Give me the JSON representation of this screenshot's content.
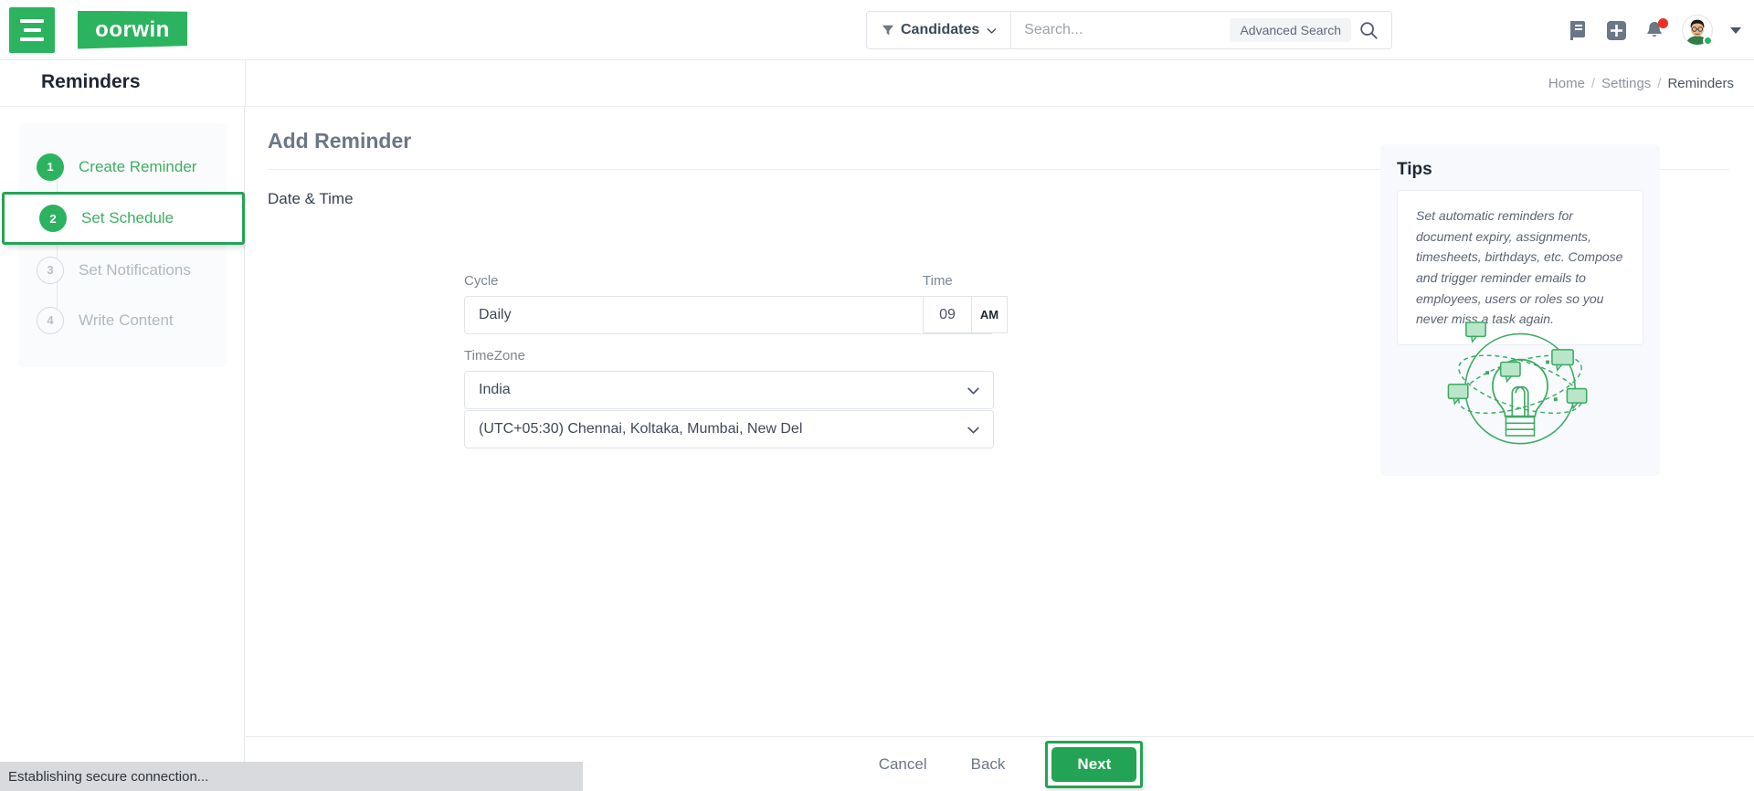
{
  "header": {
    "menu_icon": "hamburger-icon",
    "logo_text": "oorwin",
    "search": {
      "filter_label": "Candidates",
      "filter_icon": "funnel-icon",
      "chevron_icon": "chevron-down-icon",
      "placeholder": "Search...",
      "advanced_label": "Advanced Search",
      "search_icon": "search-icon"
    },
    "icons": [
      {
        "name": "note-add-icon"
      },
      {
        "name": "plus-square-icon"
      },
      {
        "name": "bell-icon",
        "has_badge": true
      }
    ],
    "avatar": {
      "name": "avatar",
      "status": "online"
    },
    "profile_caret": "caret-down-icon"
  },
  "subheader": {
    "title": "Reminders",
    "breadcrumb": [
      {
        "label": "Home",
        "active": false
      },
      {
        "label": "Settings",
        "active": false
      },
      {
        "label": "Reminders",
        "active": true
      }
    ],
    "separator": "/"
  },
  "stepper": {
    "steps": [
      {
        "num": "1",
        "label": "Create Reminder",
        "state": "done"
      },
      {
        "num": "2",
        "label": "Set Schedule",
        "state": "current"
      },
      {
        "num": "3",
        "label": "Set Notifications",
        "state": "todo"
      },
      {
        "num": "4",
        "label": "Write Content",
        "state": "todo"
      }
    ]
  },
  "main": {
    "title": "Add Reminder",
    "section_label": "Date & Time",
    "fields": {
      "cycle": {
        "label": "Cycle",
        "value": "Daily"
      },
      "timezone": {
        "label": "TimeZone",
        "value": "India"
      },
      "timezone_full": {
        "label": "",
        "value": "(UTC+05:30) Chennai, Koltaka, Mumbai, New Del"
      },
      "time": {
        "label": "Time",
        "hour": "09",
        "meridiem": "AM"
      }
    }
  },
  "tips": {
    "heading": "Tips",
    "body": "Set automatic reminders for document expiry, assignments, timesheets, birthdays, etc. Compose and trigger reminder emails to employees, users or roles so you never miss a task again.",
    "illustration": "lightbulb-network-illustration"
  },
  "footer": {
    "cancel_label": "Cancel",
    "back_label": "Back",
    "next_label": "Next"
  },
  "status": {
    "text": "Establishing secure connection..."
  },
  "colors": {
    "brand_green": "#2cb35f",
    "focus_green": "#23a455",
    "badge_red": "#ef2f24",
    "status_bar": "#d8dade",
    "tips_bg": "#f7f9fc"
  }
}
